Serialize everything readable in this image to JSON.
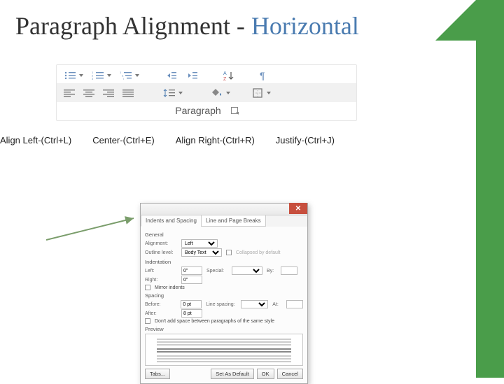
{
  "title": {
    "main": "Paragraph Alignment - ",
    "sub": "Horizontal"
  },
  "ribbon": {
    "label": "Paragraph"
  },
  "shortcuts": {
    "left": "Align Left-(Ctrl+L)",
    "center": "Center-(Ctrl+E)",
    "right": "Align Right-(Ctrl+R)",
    "justify": "Justify-(Ctrl+J)"
  },
  "dialog": {
    "tab1": "Indents and Spacing",
    "tab2": "Line and Page Breaks",
    "sec_general": "General",
    "alignment_lbl": "Alignment:",
    "alignment_val": "Left",
    "outline_lbl": "Outline level:",
    "outline_val": "Body Text",
    "collapsed_lbl": "Collapsed by default",
    "sec_indent": "Indentation",
    "left_lbl": "Left:",
    "left_val": "0\"",
    "right_lbl": "Right:",
    "right_val": "0\"",
    "special_lbl": "Special:",
    "by_lbl": "By:",
    "mirror_lbl": "Mirror indents",
    "sec_spacing": "Spacing",
    "before_lbl": "Before:",
    "before_val": "0 pt",
    "after_lbl": "After:",
    "after_val": "8 pt",
    "linespc_lbl": "Line spacing:",
    "at_lbl": "At:",
    "noadd_lbl": "Don't add space between paragraphs of the same style",
    "sec_preview": "Preview",
    "btn_tabs": "Tabs...",
    "btn_default": "Set As Default",
    "btn_ok": "OK",
    "btn_cancel": "Cancel"
  }
}
